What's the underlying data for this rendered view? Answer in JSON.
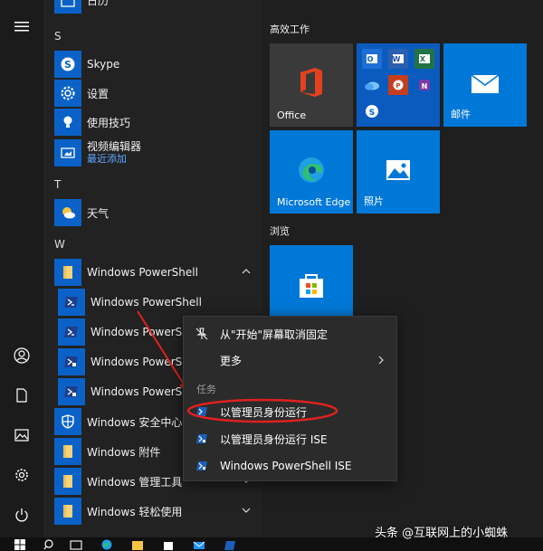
{
  "app_list": {
    "top_partial_label": "日历",
    "letters": {
      "s": "S",
      "t": "T",
      "w": "W"
    },
    "items": {
      "skype": "Skype",
      "settings": "设置",
      "tips": "使用技巧",
      "video_editor": "视频编辑器",
      "video_editor_sub": "最近添加",
      "weather": "天气",
      "powershell_folder": "Windows PowerShell",
      "ps1": "Windows PowerShell",
      "ps2": "Windows PowerSh",
      "ps3": "Windows PowerSh",
      "ps4": "Windows PowerSh",
      "security": "Windows 安全中心",
      "accessories": "Windows 附件",
      "admin_tools": "Windows 管理工具",
      "ease": "Windows 轻松使用"
    }
  },
  "tiles": {
    "group_efficient": "高效工作",
    "office": "Office",
    "mail": "邮件",
    "edge": "Microsoft Edge",
    "photos": "照片",
    "group_browse": "浏览"
  },
  "context_menu": {
    "unpin": "从\"开始\"屏幕取消固定",
    "more": "更多",
    "section_tasks": "任务",
    "run_admin": "以管理员身份运行",
    "run_admin_ise": "以管理员身份运行 ISE",
    "ps_ise": "Windows PowerShell ISE"
  },
  "watermark": "头条 @互联网上的小蜘蛛",
  "colors": {
    "accent": "#0a62c8",
    "tile_blue": "#0078d7",
    "highlight_red": "#e02020"
  }
}
